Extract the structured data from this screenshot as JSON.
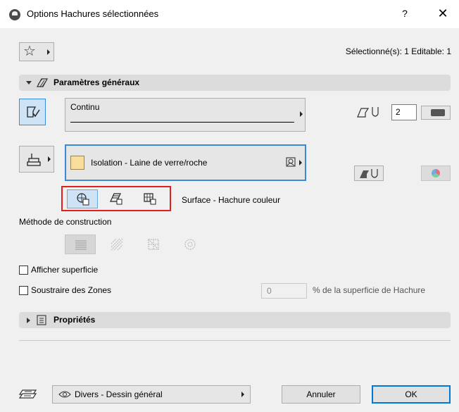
{
  "window": {
    "title": "Options Hachures sélectionnées",
    "help_label": "?",
    "close_label": "✕"
  },
  "favorites": {
    "icon": "star-icon"
  },
  "selection_info": "Sélectionné(s): 1 Editable: 1",
  "general_section": {
    "title": "Paramètres généraux",
    "icon": "hatch-settings-icon",
    "line_type": "Continu",
    "contour_pen_value": "2",
    "fill_name": "Isolation - Laine de verre/roche",
    "fill_color": "#f9dd9a",
    "category_label": "Surface - Hachure couleur",
    "construction_method_label": "Méthode de construction"
  },
  "options": {
    "show_area_label": "Afficher superficie",
    "subtract_zones_label": "Soustraire des Zones",
    "subtract_value": "0",
    "subtract_suffix": "% de la superficie de Hachure"
  },
  "properties_section": {
    "title": "Propriétés",
    "icon": "properties-icon"
  },
  "footer": {
    "layer_name": "Divers - Dessin général",
    "cancel_label": "Annuler",
    "ok_label": "OK"
  },
  "colors": {
    "accent": "#3a8ad8",
    "highlight_frame": "#e02020"
  }
}
